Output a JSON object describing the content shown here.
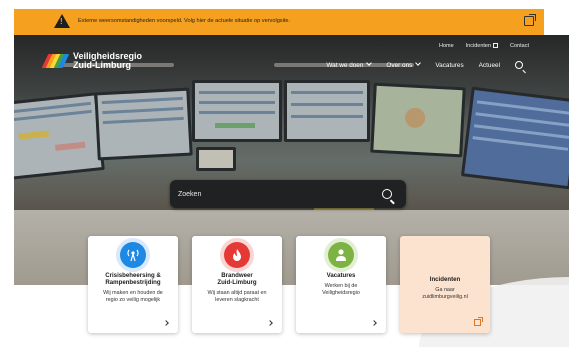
{
  "alert": {
    "text": "Externe weersomstandigheden voorspeld. Volg hier de actuele situatie op vervolgsite.",
    "icon": "warning-icon",
    "link_icon": "external-link-icon"
  },
  "brand": {
    "line1": "Veiligheidsregio",
    "line2": "Zuid-Limburg",
    "logo_colors": [
      "#e53935",
      "#f5a01e",
      "#fdd835",
      "#43a047",
      "#1e88e5"
    ]
  },
  "top_nav": [
    {
      "label": "Home"
    },
    {
      "label": "Incidenten"
    },
    {
      "label": "Contact"
    }
  ],
  "main_nav": [
    {
      "label": "Wat we doen"
    },
    {
      "label": "Over ons"
    },
    {
      "label": "Vacatures"
    },
    {
      "label": "Actueel"
    }
  ],
  "search": {
    "placeholder": "Zoeken"
  },
  "cards": [
    {
      "title_line1": "Crisisbeheersing &",
      "title_line2": "Rampenbestrijding",
      "desc_line1": "Wij maken en houden de",
      "desc_line2": "regio zo veilig mogelijk",
      "icon": "radio-tower-icon",
      "icon_color": "#1e88e5"
    },
    {
      "title_line1": "Brandweer",
      "title_line2": "Zuid-Limburg",
      "desc_line1": "Wij staan altijd paraat en",
      "desc_line2": "leveren slagkracht",
      "icon": "flame-icon",
      "icon_color": "#e53935"
    },
    {
      "title_line1": "Vacatures",
      "title_line2": "",
      "desc_line1": "Werken bij de",
      "desc_line2": "Veiligheidsregio",
      "icon": "person-icon",
      "icon_color": "#7cb342"
    },
    {
      "title_line1": "Incidenten",
      "title_line2": "",
      "desc_line1": "Ga naar",
      "desc_line2": "zuidlimburgveilig.nl",
      "icon": "",
      "icon_color": "#d9772a"
    }
  ]
}
